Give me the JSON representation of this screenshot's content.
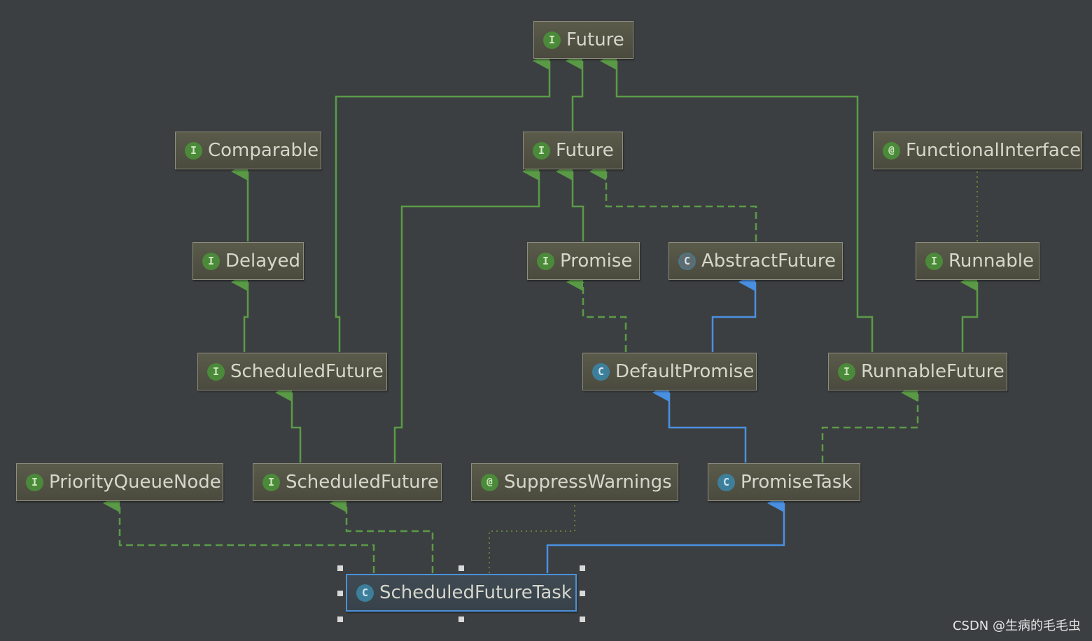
{
  "nodes": {
    "future_top": {
      "label": "Future",
      "kind": "interface",
      "badge": "I"
    },
    "comparable": {
      "label": "Comparable",
      "kind": "interface",
      "badge": "I"
    },
    "future_mid": {
      "label": "Future",
      "kind": "interface",
      "badge": "I"
    },
    "functional_interface": {
      "label": "FunctionalInterface",
      "kind": "annotation",
      "badge": "@"
    },
    "delayed": {
      "label": "Delayed",
      "kind": "interface",
      "badge": "I"
    },
    "promise": {
      "label": "Promise",
      "kind": "interface",
      "badge": "I"
    },
    "abstract_future": {
      "label": "AbstractFuture",
      "kind": "abstract-class",
      "badge": "C"
    },
    "runnable": {
      "label": "Runnable",
      "kind": "interface",
      "badge": "I"
    },
    "scheduled_future_1": {
      "label": "ScheduledFuture",
      "kind": "interface",
      "badge": "I"
    },
    "default_promise": {
      "label": "DefaultPromise",
      "kind": "class",
      "badge": "C"
    },
    "runnable_future": {
      "label": "RunnableFuture",
      "kind": "interface",
      "badge": "I"
    },
    "priority_queue_node": {
      "label": "PriorityQueueNode",
      "kind": "interface",
      "badge": "I"
    },
    "scheduled_future_2": {
      "label": "ScheduledFuture",
      "kind": "interface",
      "badge": "I"
    },
    "suppress_warnings": {
      "label": "SuppressWarnings",
      "kind": "annotation",
      "badge": "@"
    },
    "promise_task": {
      "label": "PromiseTask",
      "kind": "class",
      "badge": "C"
    },
    "scheduled_future_task": {
      "label": "ScheduledFutureTask",
      "kind": "class",
      "badge": "C"
    }
  },
  "edge_colors": {
    "interface_link": "#5a9a47",
    "extends_link": "#4a90e2",
    "annotation_link": "#6f9a3c"
  },
  "watermark": "CSDN @生病的毛毛虫"
}
